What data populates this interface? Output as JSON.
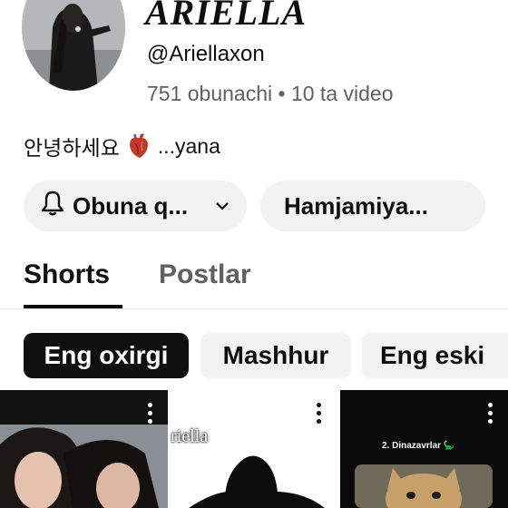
{
  "channel": {
    "title": "ARIELLA",
    "handle": "@Ariellaxon",
    "stats": "751 obunachi • 10 ta video",
    "bio_prefix": "안녕하세요",
    "bio_suffix": "...yana"
  },
  "actions": {
    "subscribe_label": "Obuna q...",
    "community_label": "Hamjamiya..."
  },
  "tabs": [
    {
      "label": "Shorts",
      "active": true
    },
    {
      "label": "Postlar",
      "active": false
    }
  ],
  "filters": [
    {
      "label": "Eng oxirgi",
      "active": true
    },
    {
      "label": "Mashhur",
      "active": false
    },
    {
      "label": "Eng eski",
      "active": false
    }
  ],
  "shorts": [
    {
      "overlay": ""
    },
    {
      "overlay": "riella"
    },
    {
      "overlay": "2. Dinazavrlar 🦕"
    }
  ],
  "colors": {
    "text": "#0f0f0f",
    "secondary_text": "#606060",
    "chip_bg": "#f2f2f2",
    "active_chip_bg": "#0f0f0f"
  }
}
